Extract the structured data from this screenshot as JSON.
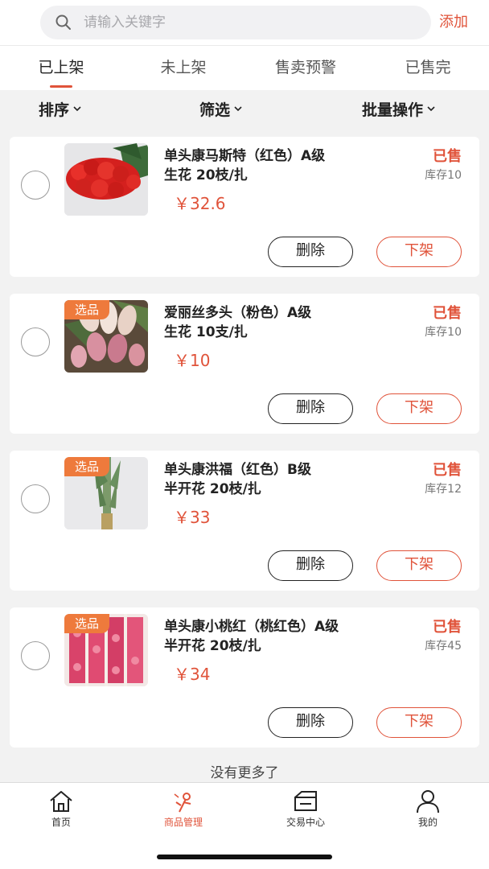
{
  "search": {
    "placeholder": "请输入关键字",
    "add_label": "添加"
  },
  "tabs": [
    {
      "label": "已上架",
      "active": true
    },
    {
      "label": "未上架",
      "active": false
    },
    {
      "label": "售卖预警",
      "active": false
    },
    {
      "label": "已售完",
      "active": false
    }
  ],
  "filters": {
    "sort_label": "排序",
    "filter_label": "筛选",
    "batch_label": "批量操作"
  },
  "products": [
    {
      "name_line1": "单头康马斯特（红色）A级",
      "name_line2": "生花 20枝/扎",
      "price": "￥32.6",
      "status": "已售",
      "stock": "库存10",
      "badge": "",
      "delete_label": "删除",
      "offshelf_label": "下架"
    },
    {
      "name_line1": "爱丽丝多头（粉色）A级",
      "name_line2": "生花 10支/扎",
      "price": "￥10",
      "status": "已售",
      "stock": "库存10",
      "badge": "选品",
      "delete_label": "删除",
      "offshelf_label": "下架"
    },
    {
      "name_line1": "单头康洪福（红色）B级",
      "name_line2": "半开花 20枝/扎",
      "price": "￥33",
      "status": "已售",
      "stock": "库存12",
      "badge": "选品",
      "delete_label": "删除",
      "offshelf_label": "下架"
    },
    {
      "name_line1": "单头康小桃红（桃红色）A级",
      "name_line2": "半开花 20枝/扎",
      "price": "￥34",
      "status": "已售",
      "stock": "库存45",
      "badge": "选品",
      "delete_label": "删除",
      "offshelf_label": "下架"
    }
  ],
  "list_footer": "没有更多了",
  "bottom_nav": [
    {
      "label": "首页",
      "icon": "home-icon",
      "active": false
    },
    {
      "label": "商品管理",
      "icon": "flower-icon",
      "active": true
    },
    {
      "label": "交易中心",
      "icon": "trade-icon",
      "active": false
    },
    {
      "label": "我的",
      "icon": "user-icon",
      "active": false
    }
  ],
  "colors": {
    "accent": "#e0533a",
    "badge": "#ee7a3c",
    "background": "#f2f2f2"
  }
}
